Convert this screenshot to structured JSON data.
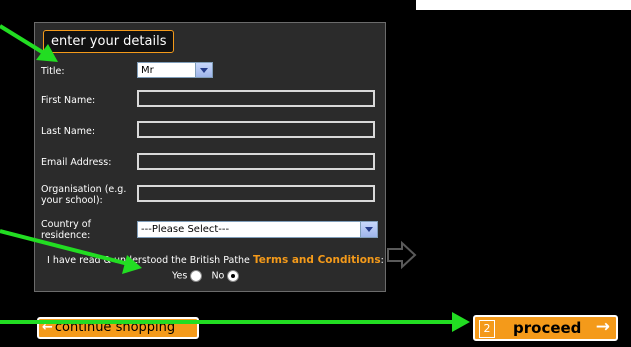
{
  "form": {
    "header": "enter your details",
    "title_label": "Title:",
    "title_value": "Mr",
    "first_name_label": "First Name:",
    "last_name_label": "Last Name:",
    "email_label": "Email Address:",
    "org_label_line1": "Organisation (e.g.",
    "org_label_line2": "your school):",
    "country_label_line1": "Country of",
    "country_label_line2": "residence:",
    "country_value": "---Please Select---",
    "terms_prefix": "I have read & understood the British Pathe",
    "terms_link": "Terms and Conditions",
    "terms_suffix": ":",
    "yes_label": "Yes",
    "no_label": "No"
  },
  "buttons": {
    "continue_arrow": "←",
    "continue_label": "continue shopping",
    "step_number": "2",
    "proceed_label": "proceed",
    "proceed_arrow": "→"
  },
  "colors": {
    "accent": "#f49a1a",
    "annotation_arrow": "#22dd22",
    "panel": "#2b2b2b"
  },
  "icons": [
    "chevron-down-icon",
    "arrow-left-icon",
    "arrow-right-icon",
    "ghost-arrow-icon",
    "annotation-arrow-icon"
  ]
}
